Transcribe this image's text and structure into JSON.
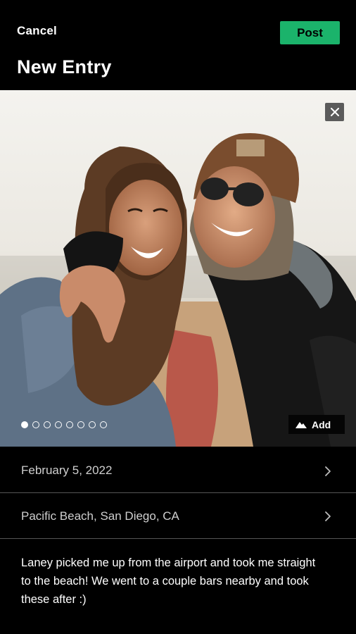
{
  "header": {
    "cancel_label": "Cancel",
    "post_label": "Post",
    "title": "New Entry"
  },
  "photo": {
    "add_label": "Add",
    "slide_count": 8,
    "active_slide": 1
  },
  "entry": {
    "date": "February 5, 2022",
    "location": "Pacific Beach, San Diego, CA",
    "note": "Laney picked me up from the airport and took me straight to the beach!  We went to a couple bars nearby and took these after  :)"
  },
  "colors": {
    "accent": "#1bb36b",
    "background": "#000000",
    "divider": "#555555"
  },
  "icons": {
    "close": "close-icon",
    "add": "mountain-icon",
    "chevron": "chevron-right-icon"
  }
}
